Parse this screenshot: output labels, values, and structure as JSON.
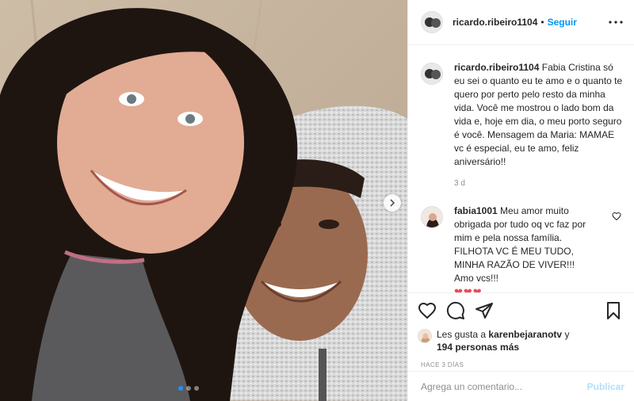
{
  "post": {
    "author": "ricardo.ribeiro1104",
    "separator": "•",
    "follow_label": "Seguir",
    "caption": {
      "username": "ricardo.ribeiro1104",
      "text": "Fabia Cristina só eu sei o quanto eu te amo e o quanto te quero por perto pelo resto da minha vida. Você me mostrou o lado bom da vida e, hoje em dia, o meu porto seguro é você. Mensagem da Maria: MAMAE vc é especial, eu te amo, feliz aniversário!!",
      "time": "3 d"
    },
    "comment": {
      "username": "fabia1001",
      "lines": [
        "Meu amor muito obrigada por tudo oq vc faz por mim e pela nossa família.",
        "FILHOTA VC É MEU TUDO, MINHA RAZÃO DE VIVER!!!",
        "Amo vcs!!!"
      ],
      "hearts": "❤❤❤"
    },
    "likes": {
      "prefix": "Les gusta a",
      "user": "karenbejaranotv",
      "middle": "y",
      "count_text": "194 personas más"
    },
    "posted": "HACE 3 DÍAS",
    "add_comment_placeholder": "Agrega un comentario...",
    "publish_label": "Publicar",
    "carousel": {
      "total": 3,
      "active": 0
    },
    "colors": {
      "link": "#0095f6",
      "publish_disabled": "#b2dffc",
      "heart": "#ed4956",
      "muted": "#8e8e8e"
    }
  }
}
